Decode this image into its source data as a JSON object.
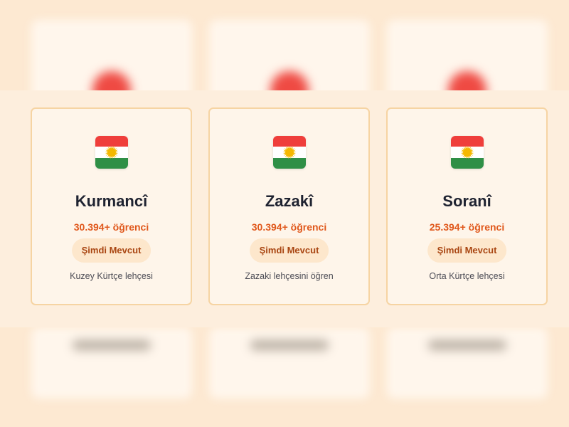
{
  "cards": [
    {
      "title": "Kurmancî",
      "students": "30.394+ öğrenci",
      "button": "Şimdi Mevcut",
      "description": "Kuzey Kürtçe lehçesi",
      "icon": "kurdistan-flag-icon"
    },
    {
      "title": "Zazakî",
      "students": "30.394+ öğrenci",
      "button": "Şimdi Mevcut",
      "description": "Zazaki lehçesini öğren",
      "icon": "kurdistan-flag-icon"
    },
    {
      "title": "Soranî",
      "students": "25.394+ öğrenci",
      "button": "Şimdi Mevcut",
      "description": "Orta Kürtçe lehçesi",
      "icon": "kurdistan-flag-icon"
    }
  ],
  "colors": {
    "background": "#fde9d2",
    "card_background": "#fef5ea",
    "card_border": "#f6d4a3",
    "title": "#1f2331",
    "students": "#e0581c",
    "button_background": "#fde7cc",
    "button_text": "#a94612",
    "flag_red": "#ef3e3b",
    "flag_white": "#ffffff",
    "flag_green": "#2f8f46",
    "flag_sun": "#f5b800"
  }
}
